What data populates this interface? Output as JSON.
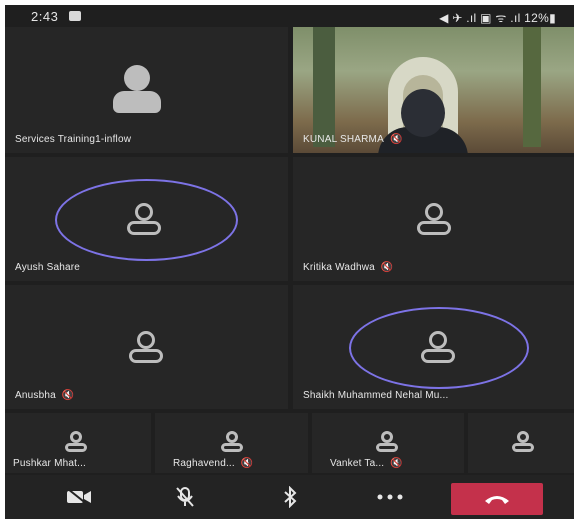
{
  "status_bar": {
    "time": "2:43",
    "right_text": "◀ ✈ .ıl ▣ ᯤ .ıl 12%▮"
  },
  "tiles": [
    {
      "name": "Services Training1-inflow",
      "muted": false,
      "video": false,
      "speaking": false
    },
    {
      "name": "KUNAL SHARMA",
      "muted": true,
      "video": true,
      "speaking": false
    },
    {
      "name": "Ayush Sahare",
      "muted": false,
      "video": false,
      "speaking": true
    },
    {
      "name": "Kritika Wadhwa",
      "muted": true,
      "video": false,
      "speaking": false
    },
    {
      "name": "Anusbha",
      "muted": true,
      "video": false,
      "speaking": false
    },
    {
      "name": "Shaikh Muhammed Nehal Mu...",
      "muted": false,
      "video": false,
      "speaking": true
    },
    {
      "name": "Pushkar Mhat...",
      "muted": false,
      "video": false,
      "speaking": false
    },
    {
      "name": "Raghavend...",
      "muted": true,
      "video": false,
      "speaking": false
    },
    {
      "name": "Vanket Ta...",
      "muted": true,
      "video": false,
      "speaking": false
    },
    {
      "name": "",
      "muted": false,
      "video": false,
      "speaking": false
    }
  ],
  "mute_glyph": "🔇",
  "controls": [
    {
      "name": "camera-off-icon",
      "glyph": "📹"
    },
    {
      "name": "mic-off-icon",
      "glyph": "🎙"
    },
    {
      "name": "bluetooth-icon",
      "glyph": "ᛒ"
    },
    {
      "name": "more-options-icon",
      "glyph": "•••"
    },
    {
      "name": "end-call-icon",
      "glyph": "☎"
    }
  ],
  "colors": {
    "background": "#1f1f1f",
    "tile": "#262626",
    "speaking_ring": "#7d73e6",
    "end_call": "#c4314b"
  }
}
